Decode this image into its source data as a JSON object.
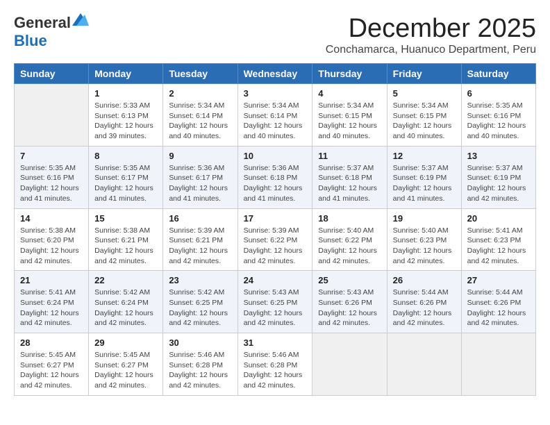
{
  "header": {
    "logo_general": "General",
    "logo_blue": "Blue",
    "month_title": "December 2025",
    "subtitle": "Conchamarca, Huanuco Department, Peru"
  },
  "calendar": {
    "days_of_week": [
      "Sunday",
      "Monday",
      "Tuesday",
      "Wednesday",
      "Thursday",
      "Friday",
      "Saturday"
    ],
    "weeks": [
      [
        {
          "day": "",
          "info": ""
        },
        {
          "day": "1",
          "info": "Sunrise: 5:33 AM\nSunset: 6:13 PM\nDaylight: 12 hours\nand 39 minutes."
        },
        {
          "day": "2",
          "info": "Sunrise: 5:34 AM\nSunset: 6:14 PM\nDaylight: 12 hours\nand 40 minutes."
        },
        {
          "day": "3",
          "info": "Sunrise: 5:34 AM\nSunset: 6:14 PM\nDaylight: 12 hours\nand 40 minutes."
        },
        {
          "day": "4",
          "info": "Sunrise: 5:34 AM\nSunset: 6:15 PM\nDaylight: 12 hours\nand 40 minutes."
        },
        {
          "day": "5",
          "info": "Sunrise: 5:34 AM\nSunset: 6:15 PM\nDaylight: 12 hours\nand 40 minutes."
        },
        {
          "day": "6",
          "info": "Sunrise: 5:35 AM\nSunset: 6:16 PM\nDaylight: 12 hours\nand 40 minutes."
        }
      ],
      [
        {
          "day": "7",
          "info": "Sunrise: 5:35 AM\nSunset: 6:16 PM\nDaylight: 12 hours\nand 41 minutes."
        },
        {
          "day": "8",
          "info": "Sunrise: 5:35 AM\nSunset: 6:17 PM\nDaylight: 12 hours\nand 41 minutes."
        },
        {
          "day": "9",
          "info": "Sunrise: 5:36 AM\nSunset: 6:17 PM\nDaylight: 12 hours\nand 41 minutes."
        },
        {
          "day": "10",
          "info": "Sunrise: 5:36 AM\nSunset: 6:18 PM\nDaylight: 12 hours\nand 41 minutes."
        },
        {
          "day": "11",
          "info": "Sunrise: 5:37 AM\nSunset: 6:18 PM\nDaylight: 12 hours\nand 41 minutes."
        },
        {
          "day": "12",
          "info": "Sunrise: 5:37 AM\nSunset: 6:19 PM\nDaylight: 12 hours\nand 41 minutes."
        },
        {
          "day": "13",
          "info": "Sunrise: 5:37 AM\nSunset: 6:19 PM\nDaylight: 12 hours\nand 42 minutes."
        }
      ],
      [
        {
          "day": "14",
          "info": "Sunrise: 5:38 AM\nSunset: 6:20 PM\nDaylight: 12 hours\nand 42 minutes."
        },
        {
          "day": "15",
          "info": "Sunrise: 5:38 AM\nSunset: 6:21 PM\nDaylight: 12 hours\nand 42 minutes."
        },
        {
          "day": "16",
          "info": "Sunrise: 5:39 AM\nSunset: 6:21 PM\nDaylight: 12 hours\nand 42 minutes."
        },
        {
          "day": "17",
          "info": "Sunrise: 5:39 AM\nSunset: 6:22 PM\nDaylight: 12 hours\nand 42 minutes."
        },
        {
          "day": "18",
          "info": "Sunrise: 5:40 AM\nSunset: 6:22 PM\nDaylight: 12 hours\nand 42 minutes."
        },
        {
          "day": "19",
          "info": "Sunrise: 5:40 AM\nSunset: 6:23 PM\nDaylight: 12 hours\nand 42 minutes."
        },
        {
          "day": "20",
          "info": "Sunrise: 5:41 AM\nSunset: 6:23 PM\nDaylight: 12 hours\nand 42 minutes."
        }
      ],
      [
        {
          "day": "21",
          "info": "Sunrise: 5:41 AM\nSunset: 6:24 PM\nDaylight: 12 hours\nand 42 minutes."
        },
        {
          "day": "22",
          "info": "Sunrise: 5:42 AM\nSunset: 6:24 PM\nDaylight: 12 hours\nand 42 minutes."
        },
        {
          "day": "23",
          "info": "Sunrise: 5:42 AM\nSunset: 6:25 PM\nDaylight: 12 hours\nand 42 minutes."
        },
        {
          "day": "24",
          "info": "Sunrise: 5:43 AM\nSunset: 6:25 PM\nDaylight: 12 hours\nand 42 minutes."
        },
        {
          "day": "25",
          "info": "Sunrise: 5:43 AM\nSunset: 6:26 PM\nDaylight: 12 hours\nand 42 minutes."
        },
        {
          "day": "26",
          "info": "Sunrise: 5:44 AM\nSunset: 6:26 PM\nDaylight: 12 hours\nand 42 minutes."
        },
        {
          "day": "27",
          "info": "Sunrise: 5:44 AM\nSunset: 6:26 PM\nDaylight: 12 hours\nand 42 minutes."
        }
      ],
      [
        {
          "day": "28",
          "info": "Sunrise: 5:45 AM\nSunset: 6:27 PM\nDaylight: 12 hours\nand 42 minutes."
        },
        {
          "day": "29",
          "info": "Sunrise: 5:45 AM\nSunset: 6:27 PM\nDaylight: 12 hours\nand 42 minutes."
        },
        {
          "day": "30",
          "info": "Sunrise: 5:46 AM\nSunset: 6:28 PM\nDaylight: 12 hours\nand 42 minutes."
        },
        {
          "day": "31",
          "info": "Sunrise: 5:46 AM\nSunset: 6:28 PM\nDaylight: 12 hours\nand 42 minutes."
        },
        {
          "day": "",
          "info": ""
        },
        {
          "day": "",
          "info": ""
        },
        {
          "day": "",
          "info": ""
        }
      ]
    ]
  }
}
